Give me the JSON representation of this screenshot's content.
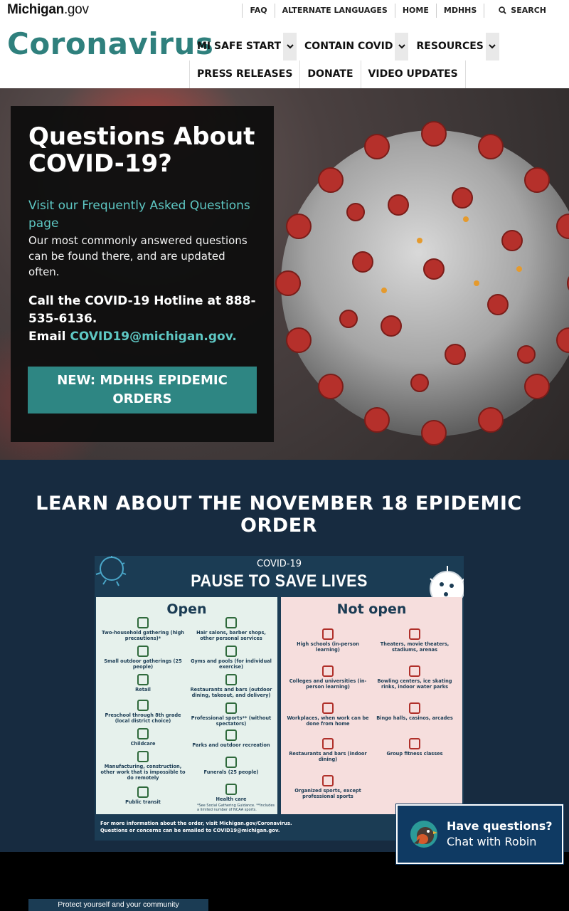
{
  "utility": {
    "brand_main": "Michigan",
    "brand_suffix": ".gov",
    "links": [
      "FAQ",
      "ALTERNATE LANGUAGES",
      "HOME",
      "MDHHS"
    ],
    "search_label": "SEARCH"
  },
  "header": {
    "site_title": "Coronavirus",
    "nav_row1": [
      "MI SAFE START",
      "CONTAIN COVID",
      "RESOURCES"
    ],
    "nav_row2": [
      "PRESS RELEASES",
      "DONATE",
      "VIDEO UPDATES"
    ]
  },
  "hero": {
    "heading": "Questions About COVID-19?",
    "faq_link": "Visit our Frequently Asked Questions page",
    "faq_desc": "Our most commonly answered questions can be found there, and are updated often.",
    "hotline": "Call the COVID-19 Hotline at 888-535-6136.",
    "email_prefix": "Email",
    "email": "COVID19@michigan.gov.",
    "orders_button": "NEW: MDHHS EPIDEMIC ORDERS"
  },
  "learn": {
    "heading": "LEARN ABOUT THE NOVEMBER 18 EPIDEMIC ORDER",
    "graphic": {
      "subtitle": "COVID-19",
      "title": "PAUSE TO SAVE LIVES",
      "open_heading": "Open",
      "closed_heading": "Not open",
      "open_left": [
        "Two-household gathering (high precautions)*",
        "Small outdoor gatherings (25 people)",
        "Retail",
        "Preschool through 8th grade (local district choice)",
        "Childcare",
        "Manufacturing, construction, other work that is impossible to do remotely",
        "Public transit"
      ],
      "open_right": [
        "Hair salons, barber shops, other personal services",
        "Gyms and pools (for individual exercise)",
        "Restaurants and bars (outdoor dining, takeout, and delivery)",
        "Professional sports** (without spectators)",
        "Parks and outdoor recreation",
        "Funerals (25 people)",
        "Health care"
      ],
      "closed_left": [
        "High schools (in-person learning)",
        "Colleges and universities (in-person learning)",
        "Workplaces, when work can be done from home",
        "Restaurants and bars (indoor dining)",
        "Organized sports, except professional sports"
      ],
      "closed_right": [
        "Theaters, movie theaters, stadiums, arenas",
        "Bowling centers, ice skating rinks, indoor water parks",
        "Bingo halls, casinos, arcades",
        "Group fitness classes"
      ],
      "note": "*See Social Gathering Guidance. **Includes a limited number of NCAA sports.",
      "footer_line1": "For more information about the order, visit Michigan.gov/Coronavirus.",
      "footer_line2": "Questions or concerns can be emailed to COVID19@michigan.gov."
    }
  },
  "chat": {
    "question": "Have questions?",
    "action": "Chat with Robin"
  },
  "bottom": {
    "banner": "Protect yourself and your community"
  },
  "colors": {
    "teal": "#2f807d",
    "navy": "#172b40",
    "chat": "#0f3a63"
  }
}
